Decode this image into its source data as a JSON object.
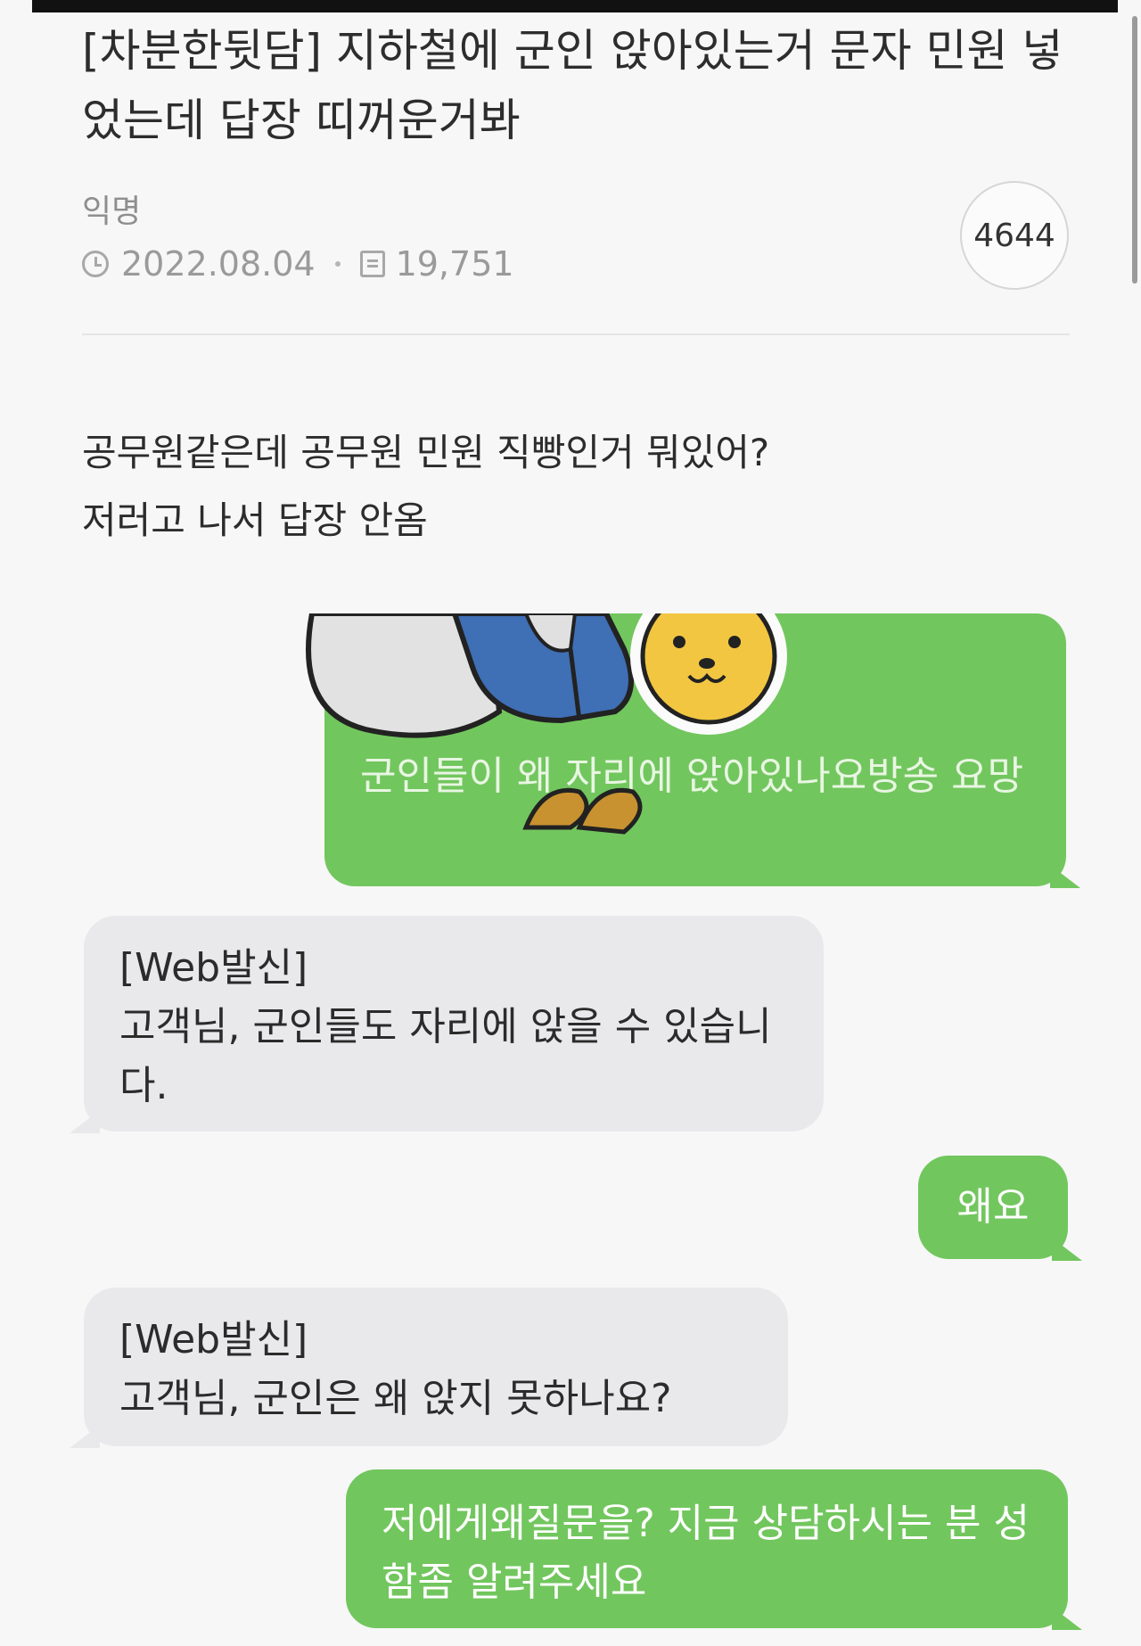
{
  "post": {
    "title": "[차분한뒷담] 지하철에 군인 앉아있는거 문자 민원 넣었는데 답장 띠꺼운거봐",
    "author": "익명",
    "date": "2022.08.04",
    "views": "19,751",
    "comment_count": "4644",
    "body_lines": [
      "공무원같은데 공무원 민원 직빵인거 뭐있어?",
      "저러고 나서 답장 안옴"
    ]
  },
  "messages": [
    {
      "direction": "out",
      "text": "군인들이 왜 자리에 앉아있나요방송 요망",
      "sticker": "bear-sticker"
    },
    {
      "direction": "in",
      "text": "[Web발신]\n고객님, 군인들도 자리에 앉을 수 있습니다."
    },
    {
      "direction": "out",
      "text": "왜요"
    },
    {
      "direction": "in",
      "text": "[Web발신]\n고객님, 군인은 왜 앉지 못하나요?"
    },
    {
      "direction": "out",
      "text": "저에게왜질문을? 지금 상담하시는 분 성함좀 알려주세요"
    }
  ],
  "colors": {
    "outgoing_bubble": "#72c65e",
    "incoming_bubble": "#e9e9ec",
    "background": "#f7f7f7"
  }
}
